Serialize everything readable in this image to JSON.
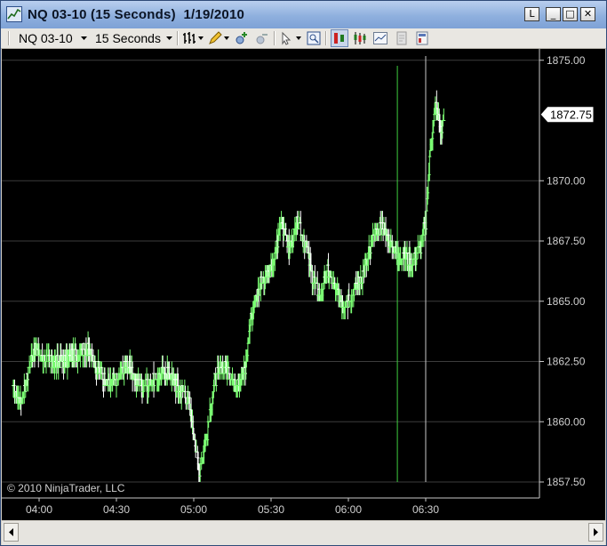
{
  "window": {
    "title": "NQ 03-10 (15 Seconds)  1/19/2010",
    "buttons": [
      "L",
      "_",
      "□",
      "✕"
    ]
  },
  "toolbar": {
    "instrument": "NQ 03-10",
    "interval": "15 Seconds",
    "icons": [
      "bar-type-icon",
      "pencil-draw-icon",
      "zoom-in-icon",
      "zoom-out-icon",
      "cursor-icon",
      "data-box-icon",
      "chart-trader-icon",
      "candlestick-icon",
      "line-chart-icon",
      "properties-icon",
      "color-properties-icon"
    ]
  },
  "chart_data": {
    "type": "ohlc",
    "instrument": "NQ 03-10",
    "interval": "15 Seconds",
    "date": "1/19/2010",
    "watermark": "© 2010 NinjaTrader, LLC",
    "last_price": "1872.75",
    "ylim": [
      1857.0,
      1876.0
    ],
    "yticks": [
      "1857.50",
      "1860.00",
      "1862.50",
      "1865.00",
      "1867.50",
      "1870.00",
      "1875.00"
    ],
    "xticks": [
      "04:00",
      "04:30",
      "05:00",
      "05:30",
      "06:00",
      "06:30"
    ],
    "grid": true,
    "colors": {
      "background": "#000000",
      "up": "#7cff74",
      "down": "#ffffff",
      "grid": "#3c3c3c",
      "marker1": "#3fcf3f",
      "marker2": "#c8c8c8"
    },
    "price_path": [
      {
        "time": "03:50",
        "price": 1861.4
      },
      {
        "time": "03:53",
        "price": 1860.7
      },
      {
        "time": "03:56",
        "price": 1862.2
      },
      {
        "time": "03:58",
        "price": 1863.0
      },
      {
        "time": "04:02",
        "price": 1862.6
      },
      {
        "time": "04:06",
        "price": 1862.4
      },
      {
        "time": "04:10",
        "price": 1862.5
      },
      {
        "time": "04:14",
        "price": 1862.8
      },
      {
        "time": "04:18",
        "price": 1863.1
      },
      {
        "time": "04:22",
        "price": 1862.4
      },
      {
        "time": "04:26",
        "price": 1861.6
      },
      {
        "time": "04:30",
        "price": 1861.7
      },
      {
        "time": "04:34",
        "price": 1862.4
      },
      {
        "time": "04:38",
        "price": 1861.6
      },
      {
        "time": "04:42",
        "price": 1861.5
      },
      {
        "time": "04:46",
        "price": 1861.9
      },
      {
        "time": "04:50",
        "price": 1862.1
      },
      {
        "time": "04:54",
        "price": 1861.4
      },
      {
        "time": "04:58",
        "price": 1861.0
      },
      {
        "time": "05:02",
        "price": 1858.0
      },
      {
        "time": "05:05",
        "price": 1859.4
      },
      {
        "time": "05:08",
        "price": 1861.7
      },
      {
        "time": "05:12",
        "price": 1862.4
      },
      {
        "time": "05:16",
        "price": 1861.6
      },
      {
        "time": "05:20",
        "price": 1862.2
      },
      {
        "time": "05:22",
        "price": 1864.3
      },
      {
        "time": "05:25",
        "price": 1865.5
      },
      {
        "time": "05:28",
        "price": 1866.0
      },
      {
        "time": "05:31",
        "price": 1866.6
      },
      {
        "time": "05:34",
        "price": 1868.4
      },
      {
        "time": "05:37",
        "price": 1867.1
      },
      {
        "time": "05:40",
        "price": 1868.2
      },
      {
        "time": "05:43",
        "price": 1867.6
      },
      {
        "time": "05:46",
        "price": 1866.0
      },
      {
        "time": "05:49",
        "price": 1865.2
      },
      {
        "time": "05:52",
        "price": 1866.3
      },
      {
        "time": "05:55",
        "price": 1865.4
      },
      {
        "time": "05:58",
        "price": 1864.9
      },
      {
        "time": "06:01",
        "price": 1865.2
      },
      {
        "time": "06:04",
        "price": 1865.7
      },
      {
        "time": "06:07",
        "price": 1866.6
      },
      {
        "time": "06:10",
        "price": 1867.7
      },
      {
        "time": "06:13",
        "price": 1868.2
      },
      {
        "time": "06:16",
        "price": 1867.5
      },
      {
        "time": "06:19",
        "price": 1866.9
      },
      {
        "time": "06:22",
        "price": 1866.8
      },
      {
        "time": "06:25",
        "price": 1866.6
      },
      {
        "time": "06:28",
        "price": 1867.3
      },
      {
        "time": "06:30",
        "price": 1868.3
      },
      {
        "time": "06:32",
        "price": 1871.6
      },
      {
        "time": "06:34",
        "price": 1873.2
      },
      {
        "time": "06:36",
        "price": 1872.0
      },
      {
        "time": "06:37",
        "price": 1872.75
      }
    ],
    "vertical_markers": [
      {
        "time": "06:19",
        "color": "#3fcf3f"
      },
      {
        "time": "06:30",
        "color": "#c8c8c8"
      }
    ]
  }
}
